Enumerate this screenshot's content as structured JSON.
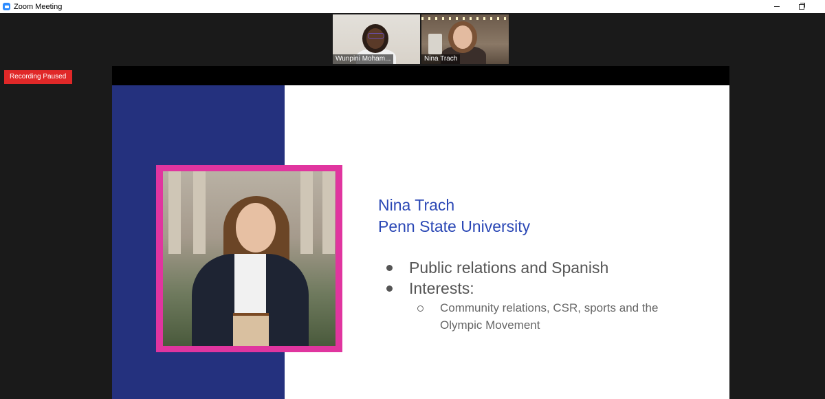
{
  "window": {
    "title": "Zoom Meeting"
  },
  "participants": [
    {
      "name": "Wunpini Moham..."
    },
    {
      "name": "Nina Trach"
    }
  ],
  "recording": {
    "status": "Recording Paused"
  },
  "slide": {
    "name": "Nina Trach",
    "university": "Penn State University",
    "bullets": [
      "Public relations and Spanish",
      "Interests:"
    ],
    "sub_bullets": [
      "Community relations, CSR, sports and the Olympic Movement"
    ]
  },
  "colors": {
    "slide_accent": "#24317e",
    "frame": "#e0359f",
    "heading": "#2a47b5",
    "recording": "#e02828"
  }
}
